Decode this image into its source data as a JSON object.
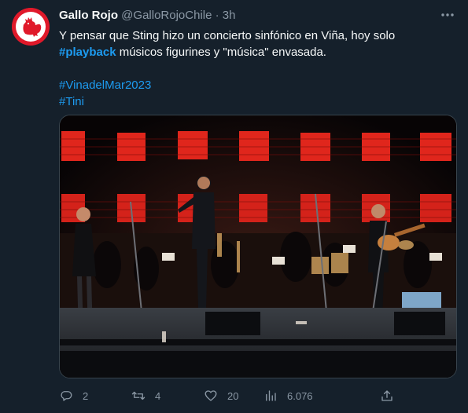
{
  "tweet": {
    "display_name": "Gallo Rojo",
    "handle": "@GalloRojoChile",
    "separator": "·",
    "time": "3h",
    "text_line1": "Y pensar que  Sting hizo un concierto sinfónico en Viña, hoy solo",
    "hashtag_playback": "#playback",
    "text_line2_rest": " músicos figurines y \"música\" envasada.",
    "hashtag_vina": "#VinadelMar2023",
    "hashtag_tini": "#Tini"
  },
  "actions": {
    "reply_count": "2",
    "retweet_count": "4",
    "like_count": "20",
    "views_count": "6.076"
  },
  "icons": [
    "rooster-logo",
    "more-icon",
    "reply-icon",
    "retweet-icon",
    "like-icon",
    "views-icon",
    "share-icon"
  ],
  "colors": {
    "background": "#15202b",
    "text": "#f7f9f9",
    "secondary": "#8b98a5",
    "link": "#1d9bf0",
    "avatar": "#e0192a"
  }
}
